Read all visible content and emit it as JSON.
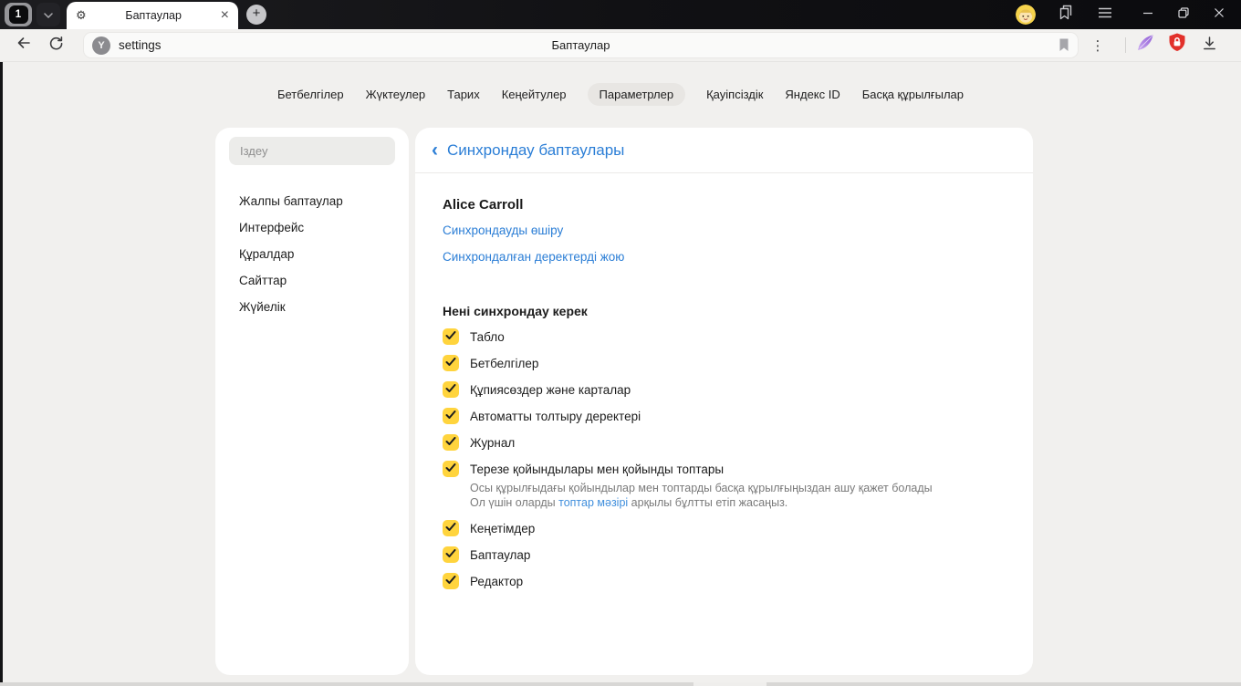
{
  "titlebar": {
    "tab_counter": "1",
    "tab_title": "Баптаулар"
  },
  "toolbar": {
    "url_text": "settings",
    "page_title": "Баптаулар"
  },
  "icons": {
    "tab_gear": "⚙",
    "tab_close": "×",
    "new_tab": "+",
    "kebab": "⋮",
    "url_badge": "Y",
    "back_chevron": "‹"
  },
  "nav": {
    "tabs": [
      {
        "label": "Бетбелгілер",
        "active": false
      },
      {
        "label": "Жүктеулер",
        "active": false
      },
      {
        "label": "Тарих",
        "active": false
      },
      {
        "label": "Кеңейтулер",
        "active": false
      },
      {
        "label": "Параметрлер",
        "active": true
      },
      {
        "label": "Қауіпсіздік",
        "active": false
      },
      {
        "label": "Яндекс ID",
        "active": false
      },
      {
        "label": "Басқа құрылғылар",
        "active": false
      }
    ]
  },
  "sidebar": {
    "search_placeholder": "Іздеу",
    "items": [
      {
        "label": "Жалпы баптаулар"
      },
      {
        "label": "Интерфейс"
      },
      {
        "label": "Құралдар"
      },
      {
        "label": "Сайттар"
      },
      {
        "label": "Жүйелік"
      }
    ]
  },
  "main": {
    "header_title": "Синхрондау баптаулары",
    "account_name": "Alice Carroll",
    "link_disable_sync": "Синхрондауды өшіру",
    "link_delete_synced": "Синхрондалған деректерді жою",
    "section_heading": "Нені синхрондау керек",
    "checkboxes": [
      {
        "label": "Табло",
        "checked": true
      },
      {
        "label": "Бетбелгілер",
        "checked": true
      },
      {
        "label": "Құпиясөздер және карталар",
        "checked": true
      },
      {
        "label": "Автоматты толтыру деректері",
        "checked": true
      },
      {
        "label": "Журнал",
        "checked": true
      },
      {
        "label": "Терезе қойындылары мен қойынды топтары",
        "checked": true,
        "description_line1": "Осы құрылғыдағы қойындылар мен топтарды басқа құрылғыңыздан ашу қажет болады",
        "description_line2_prefix": "Ол үшін оларды ",
        "description_link": "топтар мәзірі",
        "description_line2_suffix": " арқылы бұлтты етіп жасаңыз."
      },
      {
        "label": "Кеңетімдер",
        "checked": true
      },
      {
        "label": "Баптаулар",
        "checked": true
      },
      {
        "label": "Редактор",
        "checked": true
      }
    ]
  },
  "colors": {
    "accent_blue": "#2b7ed6",
    "checkbox_yellow": "#ffd43d",
    "shield_red": "#e2302a",
    "feather_purple": "#8e5bd6",
    "tabstrip_dark": "#111114",
    "page_background": "#f1f0ee"
  }
}
